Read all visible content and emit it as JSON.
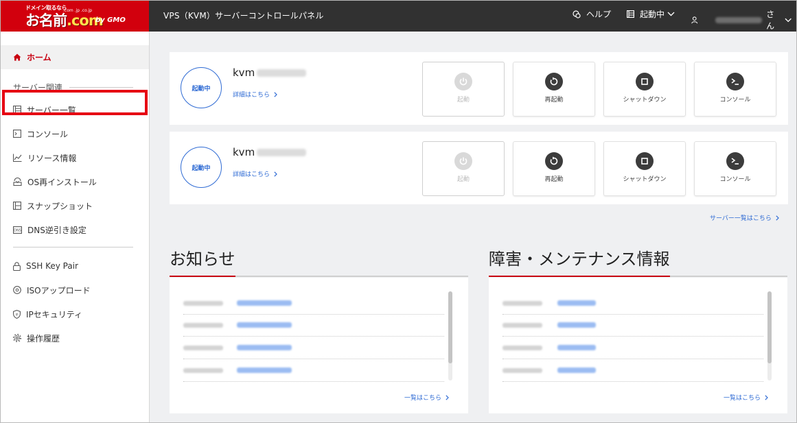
{
  "header": {
    "logo_tagline": "ドメイン取るなら",
    "logo_main": "お名前",
    "logo_com": ".com",
    "logo_tlds": ".com .jp .co.jp",
    "logo_by": "by GMO",
    "title": "VPS（KVM）サーバーコントロールパネル",
    "help_label": "ヘルプ",
    "status_label": "起動中",
    "user_suffix": "さん"
  },
  "sidebar": {
    "home_label": "ホーム",
    "section_label": "サーバー関連",
    "items": [
      {
        "label": "サーバー一覧",
        "icon": "list-icon"
      },
      {
        "label": "コンソール",
        "icon": "console-icon"
      },
      {
        "label": "リソース情報",
        "icon": "graph-icon"
      },
      {
        "label": "OS再インストール",
        "icon": "reinstall-icon"
      },
      {
        "label": "スナップショット",
        "icon": "snapshot-icon"
      },
      {
        "label": "DNS逆引き設定",
        "icon": "dns-icon"
      },
      {
        "label": "SSH Key Pair",
        "icon": "lock-icon"
      },
      {
        "label": "ISOアップロード",
        "icon": "disc-icon"
      },
      {
        "label": "IPセキュリティ",
        "icon": "shield-icon"
      },
      {
        "label": "操作履歴",
        "icon": "gear-icon"
      }
    ]
  },
  "servers": [
    {
      "status": "起動中",
      "name": "kvm",
      "detail_link": "詳細はこちら"
    },
    {
      "status": "起動中",
      "name": "kvm",
      "detail_link": "詳細はこちら"
    }
  ],
  "actions": {
    "start": "起動",
    "restart": "再起動",
    "shutdown": "シャットダウン",
    "console": "コンソール"
  },
  "server_list_link": "サーバー一覧はこちら",
  "news": {
    "title": "お知らせ",
    "more_link": "一覧はこちら"
  },
  "maintenance": {
    "title": "障害・メンテナンス情報",
    "more_link": "一覧はこちら"
  },
  "colors": {
    "brand_red": "#d2000d",
    "link_blue": "#2f6bd4",
    "header_bg": "#313131"
  }
}
